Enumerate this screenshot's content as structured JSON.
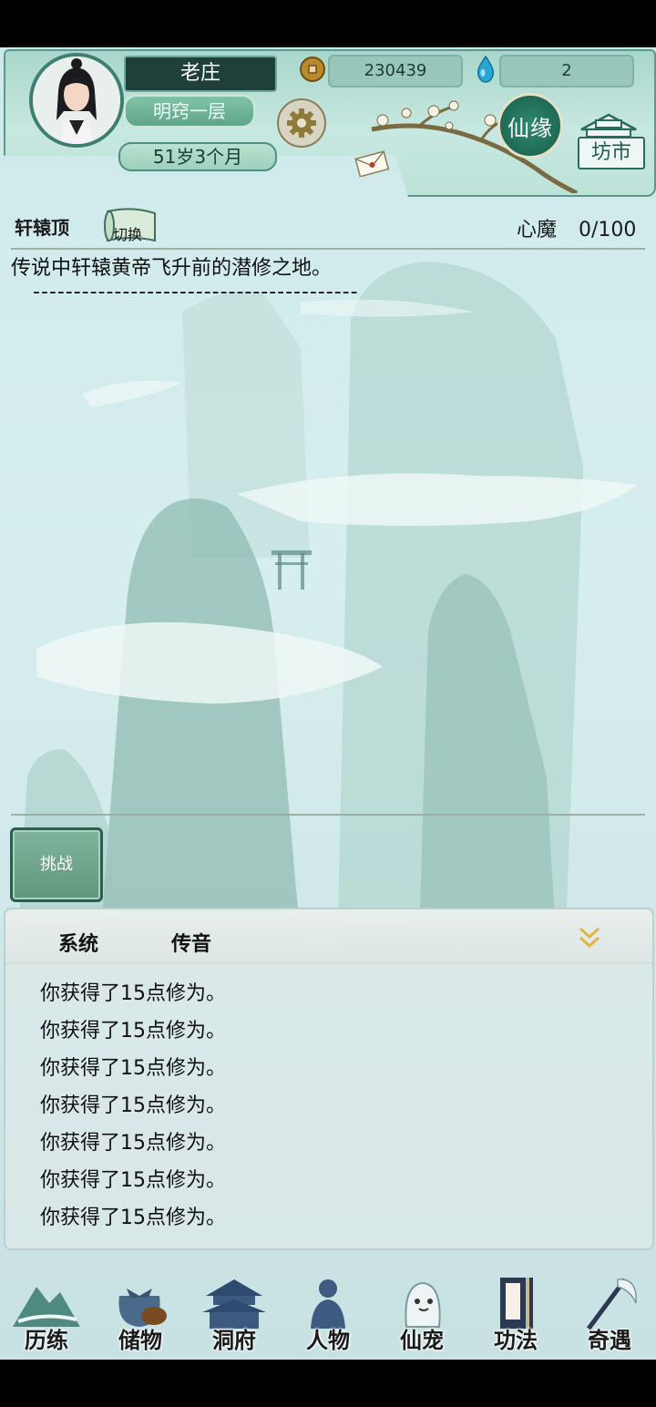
{
  "player": {
    "name": "老庄",
    "rank": "明窍一层",
    "age": "51岁3个月"
  },
  "resources": {
    "coins": "230439",
    "gems": "2"
  },
  "header_buttons": {
    "xianyuan": "仙缘",
    "market": "坊市"
  },
  "location": {
    "name": "轩辕顶",
    "switch_label": "切换",
    "heart_demon_label": "心魔",
    "heart_demon_value": "0/100",
    "description": "传说中轩辕黄帝飞升前的潜修之地。",
    "dash_line": "----------------------------------------"
  },
  "challenge_button": "挑战",
  "log": {
    "tabs": [
      "系统",
      "传音"
    ],
    "lines": [
      "你获得了15点修为。",
      "你获得了15点修为。",
      "你获得了15点修为。",
      "你获得了15点修为。",
      "你获得了15点修为。",
      "你获得了15点修为。",
      "你获得了15点修为。"
    ]
  },
  "nav": {
    "items": [
      {
        "label": "历练",
        "icon": "mountain-icon"
      },
      {
        "label": "储物",
        "icon": "bag-icon"
      },
      {
        "label": "洞府",
        "icon": "pavilion-icon"
      },
      {
        "label": "人物",
        "icon": "person-icon"
      },
      {
        "label": "仙宠",
        "icon": "pet-icon"
      },
      {
        "label": "功法",
        "icon": "book-icon"
      },
      {
        "label": "奇遇",
        "icon": "staff-icon"
      }
    ]
  },
  "colors": {
    "accent": "#1f6a55",
    "header_bg": "#bde2da",
    "background": "#d6eeee"
  }
}
